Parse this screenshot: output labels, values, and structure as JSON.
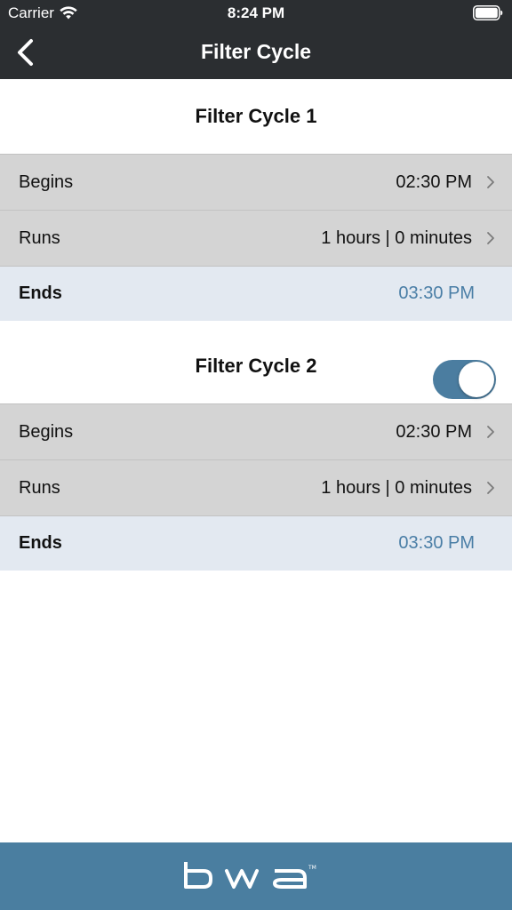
{
  "status_bar": {
    "carrier": "Carrier",
    "time": "8:24 PM"
  },
  "nav": {
    "title": "Filter Cycle",
    "back_icon": "chevron-left-icon"
  },
  "cycles": [
    {
      "title": "Filter Cycle 1",
      "begins_label": "Begins",
      "begins_value": "02:30 PM",
      "runs_label": "Runs",
      "runs_value": "1 hours | 0 minutes",
      "ends_label": "Ends",
      "ends_value": "03:30 PM"
    },
    {
      "title": "Filter Cycle 2",
      "toggle_on": true,
      "begins_label": "Begins",
      "begins_value": "02:30 PM",
      "runs_label": "Runs",
      "runs_value": "1 hours | 0 minutes",
      "ends_label": "Ends",
      "ends_value": "03:30 PM"
    }
  ],
  "footer": {
    "logo_text": "bwa"
  },
  "colors": {
    "header": "#2b2e31",
    "accent": "#4a7ea0",
    "row_gray": "#d4d4d4",
    "ends_bg": "#e3e9f1",
    "ends_text": "#4a7ea6"
  }
}
